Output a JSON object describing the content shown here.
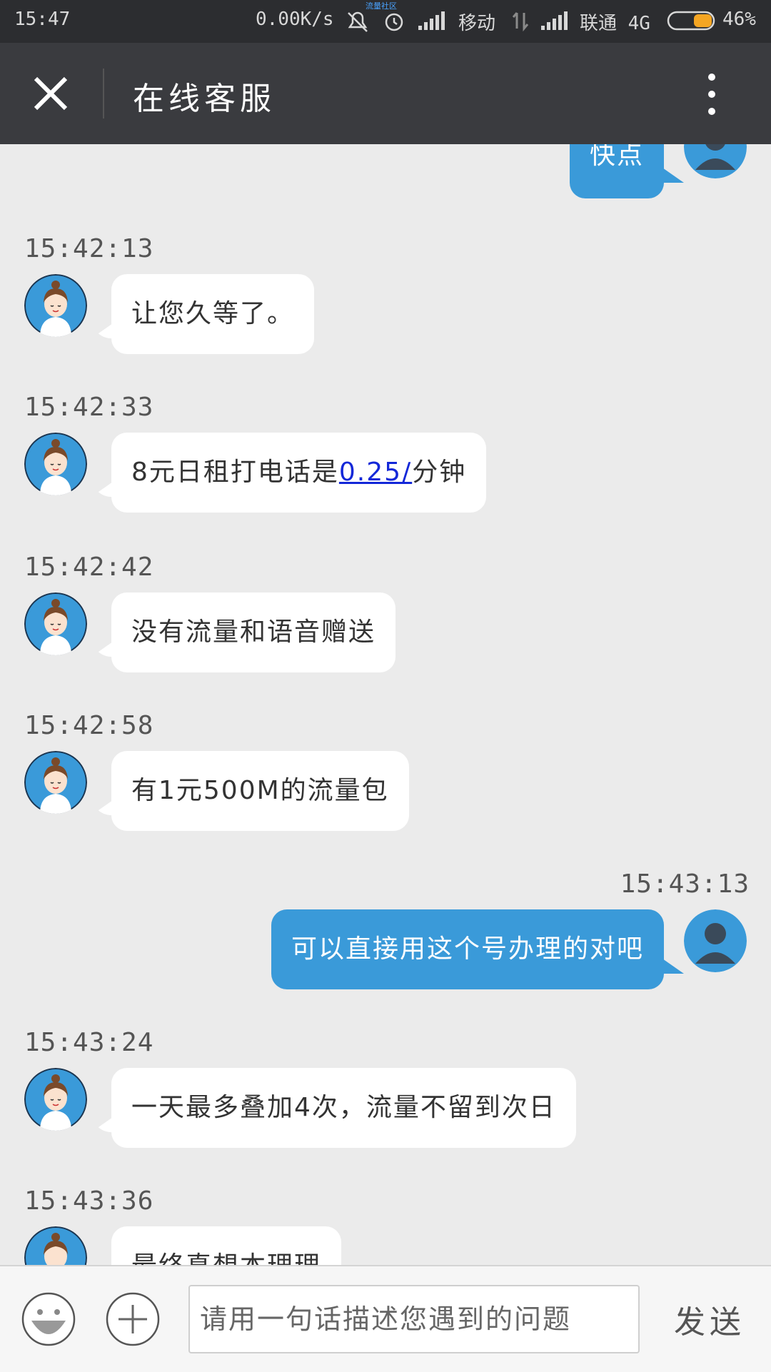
{
  "status_bar": {
    "time": "15:47",
    "speed": "0.00K/s",
    "net_label": "流量社区",
    "carrier1": "移动",
    "carrier2": "联通 4G",
    "battery": "46%"
  },
  "header": {
    "title": "在线客服"
  },
  "messages": [
    {
      "from": "user",
      "text": "快点"
    },
    {
      "from": "agent",
      "time": "15:42:13",
      "text": "让您久等了。"
    },
    {
      "from": "agent",
      "time": "15:42:33",
      "text_before": "8元日租打电话是",
      "link": "0.25/",
      "text_after": "分钟"
    },
    {
      "from": "agent",
      "time": "15:42:42",
      "text": "没有流量和语音赠送"
    },
    {
      "from": "agent",
      "time": "15:42:58",
      "text": "有1元500M的流量包"
    },
    {
      "from": "user",
      "time": "15:43:13",
      "text": "可以直接用这个号办理的对吧"
    },
    {
      "from": "agent",
      "time": "15:43:24",
      "text": "一天最多叠加4次，流量不留到次日"
    },
    {
      "from": "agent",
      "time": "15:43:36",
      "text": "最终真想本理理"
    }
  ],
  "input": {
    "placeholder": "请用一句话描述您遇到的问题",
    "send_label": "发送"
  },
  "colors": {
    "header_bg": "#3a3b3f",
    "user_bubble": "#3a9ad9",
    "agent_bubble": "#ffffff",
    "chat_bg": "#ebebeb"
  }
}
